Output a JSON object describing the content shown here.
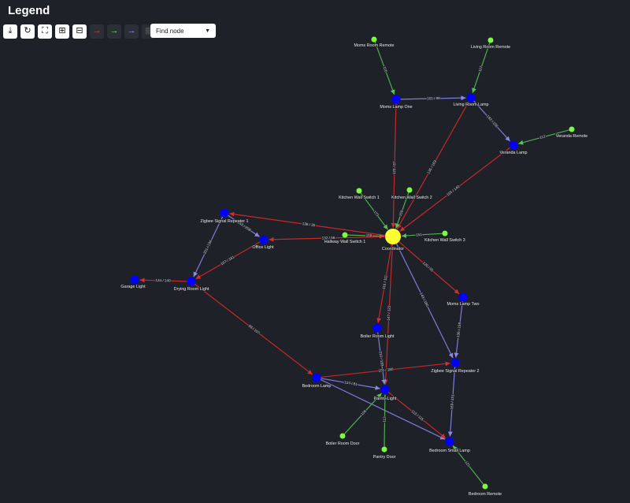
{
  "header": {
    "title": "Legend"
  },
  "toolbar": {
    "buttons": [
      {
        "name": "download-button",
        "icon": "download-icon",
        "glyph": "⤓"
      },
      {
        "name": "refresh-button",
        "icon": "refresh-icon",
        "glyph": "↻"
      },
      {
        "name": "fit-button",
        "icon": "fullscreen-icon",
        "glyph": "⛶"
      },
      {
        "name": "zoom-in-button",
        "icon": "zoom-in-icon",
        "glyph": "⊞"
      },
      {
        "name": "zoom-out-button",
        "icon": "zoom-out-icon",
        "glyph": "⊟"
      },
      {
        "name": "coordinator-links-toggle",
        "icon": "arrow-right-icon",
        "glyph": "→",
        "color": "#e53935"
      },
      {
        "name": "end-device-links-toggle",
        "icon": "arrow-right-icon",
        "glyph": "→",
        "color": "#66ff44"
      },
      {
        "name": "router-links-toggle",
        "icon": "arrow-right-icon",
        "glyph": "→",
        "color": "#9a9aff"
      },
      {
        "name": "layout-button",
        "icon": "grid-icon",
        "glyph": "▦"
      }
    ],
    "find_node": {
      "placeholder": "Find node"
    }
  },
  "colors": {
    "coordinator": "#ffff33",
    "router": "#0000ff",
    "end_device": "#7cfc40",
    "link_coordinator": "#c62828",
    "link_router": "#7c7cdc",
    "link_end_device": "#4caf50"
  },
  "graph": {
    "nodes": [
      {
        "id": "coordinator",
        "label": "Coordinator",
        "type": "coordinator"
      },
      {
        "id": "moms-room-remote",
        "label": "Moms Room Remote",
        "type": "end_device"
      },
      {
        "id": "living-room-remote",
        "label": "Living Room Remote",
        "type": "end_device"
      },
      {
        "id": "moms-lamp-one",
        "label": "Moms Lamp One",
        "type": "router"
      },
      {
        "id": "living-room-lamp",
        "label": "Living Room Lamp",
        "type": "router"
      },
      {
        "id": "veranda-remote",
        "label": "Veranda Remote",
        "type": "end_device"
      },
      {
        "id": "veranda-lamp",
        "label": "Veranda Lamp",
        "type": "router"
      },
      {
        "id": "kitchen-wall-switch-1",
        "label": "Kitchen Wall Switch 1",
        "type": "end_device"
      },
      {
        "id": "kitchen-wall-switch-2",
        "label": "Kitchen Wall Switch 2",
        "type": "end_device"
      },
      {
        "id": "kitchen-wall-switch-3",
        "label": "Kitchen Wall Switch 3",
        "type": "end_device"
      },
      {
        "id": "hallway-wall-switch-1",
        "label": "Hallway Wall Switch 1",
        "type": "end_device"
      },
      {
        "id": "zigbee-repeater-1",
        "label": "Zigbee Signal Repeater 1",
        "type": "router"
      },
      {
        "id": "office-light",
        "label": "Office Light",
        "type": "router"
      },
      {
        "id": "drying-room-light",
        "label": "Drying Room Light",
        "type": "router"
      },
      {
        "id": "garage-light",
        "label": "Garage Light",
        "type": "router"
      },
      {
        "id": "moms-lamp-two",
        "label": "Moms Lamp Two",
        "type": "router"
      },
      {
        "id": "boiler-room-light",
        "label": "Boiler Room Light",
        "type": "router"
      },
      {
        "id": "zigbee-repeater-2",
        "label": "Zigbee Signal Repeater 2",
        "type": "router"
      },
      {
        "id": "bedroom-lamp",
        "label": "Bedroom Lamp",
        "type": "router"
      },
      {
        "id": "pantry-light",
        "label": "Pantry Light",
        "type": "router"
      },
      {
        "id": "boiler-room-door",
        "label": "Boiler Room Door",
        "type": "end_device"
      },
      {
        "id": "pantry-door",
        "label": "Pantry Door",
        "type": "end_device"
      },
      {
        "id": "bedroom-small-lamp",
        "label": "Bedroom Small Lamp",
        "type": "router"
      },
      {
        "id": "bedroom-remote",
        "label": "Bedroom Remote",
        "type": "end_device"
      }
    ],
    "links": [
      {
        "from": "moms-room-remote",
        "to": "moms-lamp-one",
        "kind": "end_device",
        "label": "116"
      },
      {
        "from": "living-room-remote",
        "to": "living-room-lamp",
        "kind": "end_device",
        "label": "117"
      },
      {
        "from": "moms-lamp-one",
        "to": "living-room-lamp",
        "kind": "router",
        "label": "101 / 98"
      },
      {
        "from": "living-room-lamp",
        "to": "veranda-lamp",
        "kind": "router",
        "label": "182 / 155"
      },
      {
        "from": "veranda-remote",
        "to": "veranda-lamp",
        "kind": "end_device",
        "label": "112"
      },
      {
        "from": "moms-lamp-one",
        "to": "coordinator",
        "kind": "coordinator",
        "label": "123 / 87"
      },
      {
        "from": "living-room-lamp",
        "to": "coordinator",
        "kind": "coordinator",
        "label": "135 / 183"
      },
      {
        "from": "veranda-lamp",
        "to": "coordinator",
        "kind": "coordinator",
        "label": "155 / 140"
      },
      {
        "from": "kitchen-wall-switch-1",
        "to": "coordinator",
        "kind": "end_device",
        "label": "173"
      },
      {
        "from": "kitchen-wall-switch-2",
        "to": "coordinator",
        "kind": "end_device",
        "label": "159"
      },
      {
        "from": "kitchen-wall-switch-3",
        "to": "coordinator",
        "kind": "end_device",
        "label": "151"
      },
      {
        "from": "hallway-wall-switch-1",
        "to": "coordinator",
        "kind": "end_device",
        "label": "158"
      },
      {
        "from": "coordinator",
        "to": "zigbee-repeater-1",
        "kind": "coordinator",
        "label": "136 / 35"
      },
      {
        "from": "coordinator",
        "to": "office-light",
        "kind": "coordinator",
        "label": "132 / 56"
      },
      {
        "from": "zigbee-repeater-1",
        "to": "office-light",
        "kind": "router",
        "label": "163 / 208"
      },
      {
        "from": "zigbee-repeater-1",
        "to": "drying-room-light",
        "kind": "router",
        "label": "201 / 194"
      },
      {
        "from": "office-light",
        "to": "drying-room-light",
        "kind": "coordinator",
        "label": "167 / 161"
      },
      {
        "from": "drying-room-light",
        "to": "garage-light",
        "kind": "coordinator",
        "label": "134 / 140"
      },
      {
        "from": "drying-room-light",
        "to": "bedroom-lamp",
        "kind": "coordinator",
        "label": "98 / 107"
      },
      {
        "from": "coordinator",
        "to": "moms-lamp-two",
        "kind": "coordinator",
        "label": "120 / 81"
      },
      {
        "from": "coordinator",
        "to": "boiler-room-light",
        "kind": "coordinator",
        "label": "116 / 111"
      },
      {
        "from": "coordinator",
        "to": "pantry-light",
        "kind": "coordinator",
        "label": "147 / 123"
      },
      {
        "from": "coordinator",
        "to": "zigbee-repeater-2",
        "kind": "router",
        "label": "143 / 180"
      },
      {
        "from": "moms-lamp-two",
        "to": "zigbee-repeater-2",
        "kind": "router",
        "label": "136 / 159"
      },
      {
        "from": "boiler-room-light",
        "to": "pantry-light",
        "kind": "router",
        "label": "210 / 183"
      },
      {
        "from": "bedroom-lamp",
        "to": "zigbee-repeater-2",
        "kind": "coordinator",
        "label": "101 / 180"
      },
      {
        "from": "bedroom-lamp",
        "to": "bedroom-small-lamp",
        "kind": "router",
        "label": ""
      },
      {
        "from": "zigbee-repeater-2",
        "to": "bedroom-small-lamp",
        "kind": "router",
        "label": "169 / 151"
      },
      {
        "from": "pantry-light",
        "to": "bedroom-small-lamp",
        "kind": "coordinator",
        "label": "113 / 115"
      },
      {
        "from": "boiler-room-door",
        "to": "pantry-light",
        "kind": "end_device",
        "label": "106"
      },
      {
        "from": "pantry-door",
        "to": "pantry-light",
        "kind": "end_device",
        "label": "113"
      },
      {
        "from": "bedroom-remote",
        "to": "bedroom-small-lamp",
        "kind": "end_device",
        "label": "121"
      },
      {
        "from": "bedroom-lamp",
        "to": "pantry-light",
        "kind": "router",
        "label": "157 / 81"
      }
    ]
  }
}
